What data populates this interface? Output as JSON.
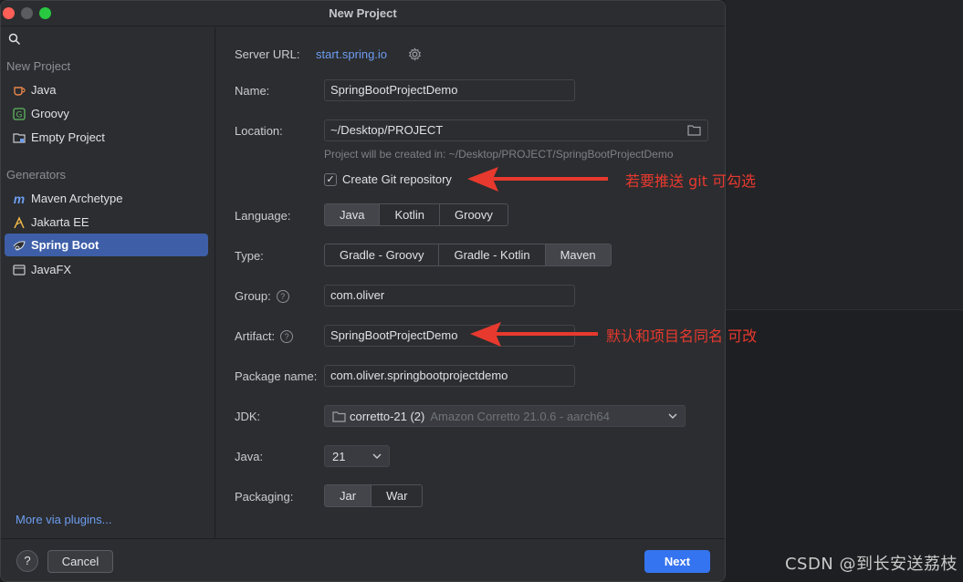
{
  "window": {
    "title": "New Project"
  },
  "sidebar": {
    "new_project_label": "New Project",
    "items": [
      {
        "label": "Java",
        "icon": "java-cup-icon"
      },
      {
        "label": "Groovy",
        "icon": "groovy-icon"
      },
      {
        "label": "Empty Project",
        "icon": "empty-project-icon"
      }
    ],
    "generators_label": "Generators",
    "generators": [
      {
        "label": "Maven Archetype",
        "icon": "maven-icon"
      },
      {
        "label": "Jakarta EE",
        "icon": "jakarta-icon"
      },
      {
        "label": "Spring Boot",
        "icon": "spring-boot-icon",
        "selected": true
      },
      {
        "label": "JavaFX",
        "icon": "javafx-icon"
      }
    ],
    "more_link": "More via plugins..."
  },
  "form": {
    "server_url_label": "Server URL:",
    "server_url_value": "start.spring.io",
    "name_label": "Name:",
    "name_value": "SpringBootProjectDemo",
    "location_label": "Location:",
    "location_value": "~/Desktop/PROJECT",
    "location_hint": "Project will be created in: ~/Desktop/PROJECT/SpringBootProjectDemo",
    "git_label": "Create Git repository",
    "git_checked": true,
    "language_label": "Language:",
    "language_options": [
      "Java",
      "Kotlin",
      "Groovy"
    ],
    "language_selected": "Java",
    "type_label": "Type:",
    "type_options": [
      "Gradle - Groovy",
      "Gradle - Kotlin",
      "Maven"
    ],
    "type_selected": "Maven",
    "group_label": "Group:",
    "group_value": "com.oliver",
    "artifact_label": "Artifact:",
    "artifact_value": "SpringBootProjectDemo",
    "package_label": "Package name:",
    "package_value": "com.oliver.springbootprojectdemo",
    "jdk_label": "JDK:",
    "jdk_value": "corretto-21 (2)",
    "jdk_detail": "Amazon Corretto 21.0.6 - aarch64",
    "java_label": "Java:",
    "java_value": "21",
    "packaging_label": "Packaging:",
    "packaging_options": [
      "Jar",
      "War"
    ],
    "packaging_selected": "Jar"
  },
  "footer": {
    "help_label": "?",
    "cancel_label": "Cancel",
    "next_label": "Next"
  },
  "annotations": {
    "git_note": "若要推送 git 可勾选",
    "artifact_note": "默认和项目名同名 可改",
    "color": "#e8392e"
  },
  "watermark": "CSDN @到长安送荔枝"
}
